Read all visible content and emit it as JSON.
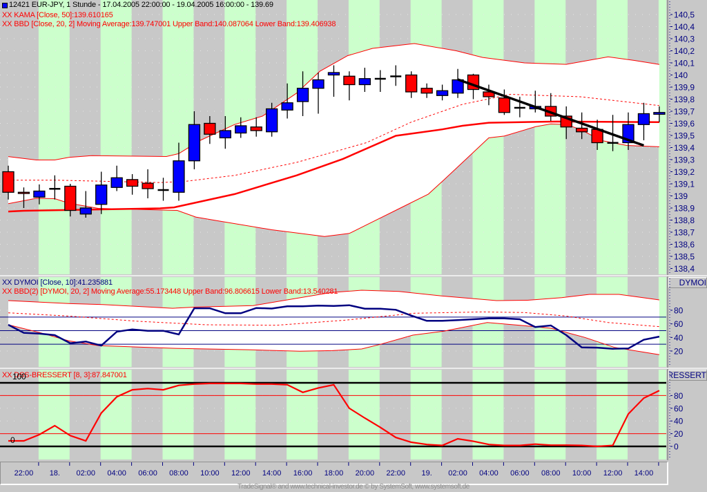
{
  "header": {
    "icon": "blue-square-icon",
    "title": "12421  EUR-JPY, 1 Stunde - 17.04.2005 22:00:00 - 19.04.2005 16:00:00 - 139.69",
    "kama_label": "XX KAMA [Close, 50]:139.610165",
    "bbd_label": "XX BBD [Close, 20, 2] Moving Average:139.747001 Upper Band:140.087064 Lower Band:139.406938"
  },
  "dymoi_panel": {
    "label": "XX DYMOI [Close, 10]:41.235881",
    "bbd_label": "XX BBD(2) [DYMOI, 20, 2] Moving Average:55.173448 Upper Band:96.806615 Lower Band:13.540281",
    "axis_title": "DYMOI"
  },
  "bressert_panel": {
    "label": "XX DSS-BRESSERT [8, 3]:87.847001",
    "level_100": "100",
    "level_0": "0",
    "axis_title": "BRESSERT"
  },
  "footer": "TradeSignal® and www.technical-investor.de © by SystemSoft, www.systemsoft.de",
  "colors": {
    "up": "#0000ff",
    "down": "#ff0000",
    "indicator": "#ff0000",
    "dymoi": "#000080",
    "green_band": "#ccffcc",
    "grey_band": "#c8c8c8"
  },
  "chart_data": {
    "type": "candlestick",
    "x_labels": [
      "22:00",
      "18.",
      "02:00",
      "04:00",
      "06:00",
      "08:00",
      "10:00",
      "12:00",
      "14:00",
      "16:00",
      "18:00",
      "20:00",
      "22:00",
      "19.",
      "02:00",
      "04:00",
      "06:00",
      "08:00",
      "10:00",
      "12:00",
      "14:00"
    ],
    "x_label_start_index": 1,
    "x_label_step": 2,
    "price": {
      "ylim": [
        138.35,
        140.55
      ],
      "ticks": [
        140.5,
        140.4,
        140.3,
        140.2,
        140.1,
        140.0,
        139.9,
        139.8,
        139.7,
        139.6,
        139.5,
        139.4,
        139.3,
        139.2,
        139.1,
        139.0,
        138.9,
        138.8,
        138.7,
        138.6,
        138.5,
        138.4
      ],
      "tick_labels": [
        "140,5",
        "140,4",
        "140,3",
        "140,2",
        "140,1",
        "140",
        "139,9",
        "139,8",
        "139,7",
        "139,6",
        "139,5",
        "139,4",
        "139,3",
        "139,2",
        "139,1",
        "139",
        "138,9",
        "138,8",
        "138,7",
        "138,6",
        "138,5",
        "138,4"
      ],
      "candles_ohlc": [
        [
          139.2,
          139.25,
          138.97,
          139.03
        ],
        [
          139.03,
          139.07,
          138.9,
          139.02
        ],
        [
          138.99,
          139.095,
          138.93,
          139.04
        ],
        [
          139.06,
          139.17,
          138.97,
          139.06
        ],
        [
          139.08,
          139.1,
          138.83,
          138.88
        ],
        [
          138.85,
          139.04,
          138.82,
          138.9
        ],
        [
          138.93,
          139.2,
          138.85,
          139.09
        ],
        [
          139.07,
          139.25,
          139.04,
          139.15
        ],
        [
          139.135,
          139.18,
          139.01,
          139.08
        ],
        [
          139.105,
          139.22,
          138.98,
          139.06
        ],
        [
          139.05,
          139.15,
          138.96,
          139.05
        ],
        [
          139.03,
          139.44,
          138.96,
          139.29
        ],
        [
          139.29,
          139.7,
          139.22,
          139.59
        ],
        [
          139.6,
          139.66,
          139.43,
          139.51
        ],
        [
          139.48,
          139.66,
          139.39,
          139.54
        ],
        [
          139.52,
          139.65,
          139.48,
          139.58
        ],
        [
          139.57,
          139.65,
          139.49,
          139.54
        ],
        [
          139.53,
          139.77,
          139.49,
          139.72
        ],
        [
          139.71,
          139.93,
          139.64,
          139.77
        ],
        [
          139.78,
          140.03,
          139.66,
          139.89
        ],
        [
          139.89,
          140.02,
          139.68,
          139.96
        ],
        [
          140.0,
          140.08,
          139.82,
          140.02
        ],
        [
          139.99,
          140.03,
          139.79,
          139.92
        ],
        [
          139.92,
          140.06,
          139.86,
          139.97
        ],
        [
          139.97,
          140.04,
          139.86,
          139.97
        ],
        [
          139.99,
          140.08,
          139.91,
          139.99
        ],
        [
          140.0,
          140.03,
          139.81,
          139.86
        ],
        [
          139.89,
          139.93,
          139.81,
          139.85
        ],
        [
          139.83,
          139.92,
          139.79,
          139.87
        ],
        [
          139.85,
          140.05,
          139.81,
          139.96
        ],
        [
          140.0,
          140.01,
          139.8,
          139.88
        ],
        [
          139.86,
          139.92,
          139.75,
          139.82
        ],
        [
          139.81,
          139.88,
          139.67,
          139.69
        ],
        [
          139.73,
          139.82,
          139.65,
          139.73
        ],
        [
          139.72,
          139.87,
          139.69,
          139.74
        ],
        [
          139.74,
          139.85,
          139.62,
          139.66
        ],
        [
          139.66,
          139.74,
          139.47,
          139.57
        ],
        [
          139.56,
          139.69,
          139.47,
          139.53
        ],
        [
          139.55,
          139.63,
          139.38,
          139.44
        ],
        [
          139.44,
          139.67,
          139.37,
          139.44
        ],
        [
          139.44,
          139.69,
          139.38,
          139.59
        ],
        [
          139.59,
          139.77,
          139.46,
          139.68
        ],
        [
          139.675,
          139.74,
          139.61,
          139.69
        ]
      ],
      "kama": [
        [
          0,
          138.871
        ],
        [
          1,
          138.877
        ],
        [
          9.8,
          138.897
        ],
        [
          10.7,
          138.905
        ],
        [
          14.6,
          139.015
        ],
        [
          18.6,
          139.17
        ],
        [
          21.6,
          139.306
        ],
        [
          25,
          139.497
        ],
        [
          28,
          139.55
        ],
        [
          29.3,
          139.58
        ],
        [
          31,
          139.605
        ],
        [
          35.4,
          139.615
        ],
        [
          42,
          139.61
        ]
      ],
      "bb_upper": [
        [
          0,
          139.325
        ],
        [
          1.8,
          139.297
        ],
        [
          3,
          139.297
        ],
        [
          3.9,
          139.318
        ],
        [
          5.4,
          139.333
        ],
        [
          10.2,
          139.326
        ],
        [
          11,
          139.35
        ],
        [
          12.4,
          139.46
        ],
        [
          14.6,
          139.59
        ],
        [
          16.4,
          139.66
        ],
        [
          18.6,
          139.85
        ],
        [
          20.1,
          140.03
        ],
        [
          21.9,
          140.16
        ],
        [
          23.5,
          140.22
        ],
        [
          26.2,
          140.26
        ],
        [
          28.9,
          140.2
        ],
        [
          30.6,
          140.145
        ],
        [
          33.3,
          140.1
        ],
        [
          36,
          140.088
        ],
        [
          38.7,
          140.15
        ],
        [
          40.4,
          140.12
        ],
        [
          42,
          140.087
        ]
      ],
      "bb_middle": [
        [
          0,
          139.13
        ],
        [
          3.2,
          139.13
        ],
        [
          9.8,
          139.11
        ],
        [
          11.4,
          139.12
        ],
        [
          14.6,
          139.17
        ],
        [
          18.6,
          139.277
        ],
        [
          23.1,
          139.44
        ],
        [
          26,
          139.61
        ],
        [
          29.3,
          139.757
        ],
        [
          32.4,
          139.84
        ],
        [
          36.9,
          139.82
        ],
        [
          41.3,
          139.757
        ],
        [
          42,
          139.747
        ]
      ],
      "bb_lower": [
        [
          0,
          138.936
        ],
        [
          1.8,
          138.98
        ],
        [
          3,
          138.977
        ],
        [
          3.9,
          138.94
        ],
        [
          5.8,
          138.897
        ],
        [
          10.9,
          138.88
        ],
        [
          12.1,
          138.825
        ],
        [
          13.7,
          138.79
        ],
        [
          17,
          138.72
        ],
        [
          20.4,
          138.664
        ],
        [
          22,
          138.69
        ],
        [
          23.5,
          138.785
        ],
        [
          25.3,
          138.9
        ],
        [
          27.1,
          139.015
        ],
        [
          28,
          139.12
        ],
        [
          30,
          139.36
        ],
        [
          31,
          139.48
        ],
        [
          32,
          139.495
        ],
        [
          34,
          139.572
        ],
        [
          35,
          139.595
        ],
        [
          36,
          139.59
        ],
        [
          36.9,
          139.55
        ],
        [
          38.3,
          139.457
        ],
        [
          39.9,
          139.417
        ],
        [
          42,
          139.406
        ]
      ],
      "trendline": [
        [
          29,
          139.963
        ],
        [
          41,
          139.417
        ]
      ]
    },
    "dymoi": {
      "ticks": [
        80,
        60,
        40,
        20
      ],
      "tick_labels": [
        "80",
        "60",
        "40",
        "20"
      ],
      "hlines": [
        70,
        50,
        30
      ],
      "values": [
        58.6,
        46.7,
        45.7,
        43.4,
        31.5,
        33.9,
        28,
        48.5,
        51.8,
        49.8,
        49.8,
        44.4,
        83,
        83,
        75.6,
        75.6,
        83.4,
        82.5,
        85.8,
        85.8,
        86.8,
        86.4,
        87.4,
        82.3,
        82.3,
        80.7,
        72.2,
        64.4,
        64.4,
        65.5,
        66.8,
        68.1,
        68.1,
        66.8,
        55.3,
        57.6,
        43.4,
        25.4,
        25,
        23.3,
        23.7,
        36.6,
        41.2
      ],
      "bb_upper": [
        [
          0,
          94.2
        ],
        [
          4,
          89.8
        ],
        [
          6.1,
          88.4
        ],
        [
          10.6,
          83
        ],
        [
          12.1,
          84.7
        ],
        [
          15.8,
          86.8
        ],
        [
          20.8,
          106
        ],
        [
          22.8,
          109.5
        ],
        [
          25.2,
          107.8
        ],
        [
          28,
          101
        ],
        [
          31.5,
          94.2
        ],
        [
          33.5,
          94.7
        ],
        [
          35.7,
          98.6
        ],
        [
          37.5,
          103.4
        ],
        [
          39.4,
          103.4
        ],
        [
          42,
          95.3
        ]
      ],
      "bb_middle": [
        [
          0,
          76.2
        ],
        [
          3.9,
          71.5
        ],
        [
          8.4,
          63.7
        ],
        [
          12.8,
          58.6
        ],
        [
          17.3,
          57.9
        ],
        [
          21.7,
          65.4
        ],
        [
          26.2,
          75.6
        ],
        [
          30.6,
          77.6
        ],
        [
          33.3,
          76.6
        ],
        [
          36,
          71.5
        ],
        [
          38.7,
          62
        ],
        [
          42,
          55.9
        ]
      ],
      "bb_lower": [
        [
          0,
          58.6
        ],
        [
          2.1,
          46.7
        ],
        [
          3.9,
          35
        ],
        [
          5.8,
          28
        ],
        [
          10.6,
          24
        ],
        [
          15.5,
          21.9
        ],
        [
          18.8,
          19.7
        ],
        [
          20.9,
          20.6
        ],
        [
          22.8,
          23
        ],
        [
          24,
          29.8
        ],
        [
          26.1,
          43.4
        ],
        [
          28.1,
          49.2
        ],
        [
          30.9,
          62
        ],
        [
          33,
          57.9
        ],
        [
          35,
          53.6
        ],
        [
          37.2,
          40
        ],
        [
          39.1,
          25.4
        ],
        [
          42,
          14.6
        ]
      ]
    },
    "bressert": {
      "ticks": [
        80,
        60,
        40,
        20,
        0
      ],
      "tick_labels": [
        "80",
        "60",
        "40",
        "20",
        "0"
      ],
      "levels_black": [
        100,
        0
      ],
      "levels_red": [
        80,
        20
      ],
      "values": [
        8.7,
        8.7,
        18.5,
        32.6,
        17,
        8.7,
        52.5,
        78,
        89,
        91,
        89,
        96,
        98,
        99,
        99,
        99,
        98,
        98,
        97,
        85,
        92,
        97,
        60,
        44.6,
        30,
        14,
        6.5,
        3,
        1.5,
        12,
        8,
        3,
        1.5,
        1.5,
        3.6,
        2,
        2,
        1.5,
        0,
        1.5,
        51,
        76,
        87.8
      ]
    }
  }
}
